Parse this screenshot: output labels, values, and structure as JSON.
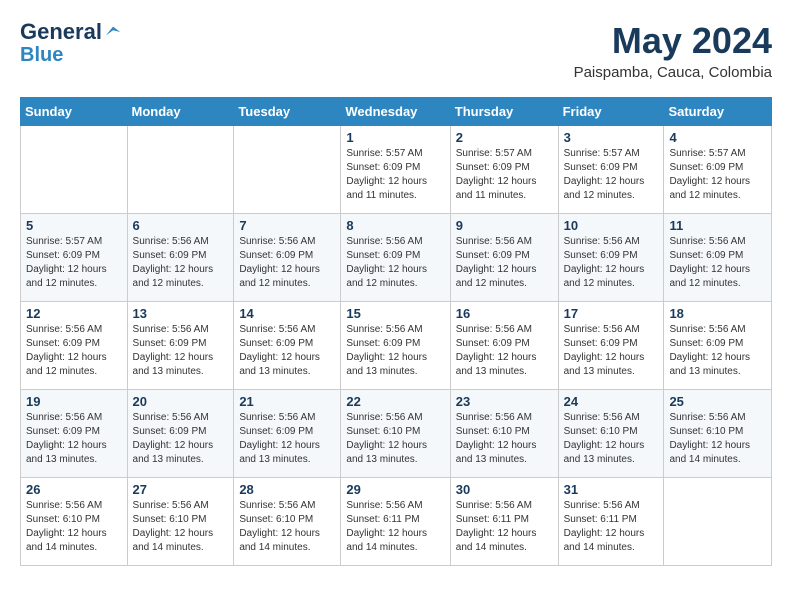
{
  "header": {
    "logo_line1": "General",
    "logo_line2": "Blue",
    "month_title": "May 2024",
    "location": "Paispamba, Cauca, Colombia"
  },
  "weekdays": [
    "Sunday",
    "Monday",
    "Tuesday",
    "Wednesday",
    "Thursday",
    "Friday",
    "Saturday"
  ],
  "weeks": [
    [
      {
        "day": "",
        "info": ""
      },
      {
        "day": "",
        "info": ""
      },
      {
        "day": "",
        "info": ""
      },
      {
        "day": "1",
        "info": "Sunrise: 5:57 AM\nSunset: 6:09 PM\nDaylight: 12 hours\nand 11 minutes."
      },
      {
        "day": "2",
        "info": "Sunrise: 5:57 AM\nSunset: 6:09 PM\nDaylight: 12 hours\nand 11 minutes."
      },
      {
        "day": "3",
        "info": "Sunrise: 5:57 AM\nSunset: 6:09 PM\nDaylight: 12 hours\nand 12 minutes."
      },
      {
        "day": "4",
        "info": "Sunrise: 5:57 AM\nSunset: 6:09 PM\nDaylight: 12 hours\nand 12 minutes."
      }
    ],
    [
      {
        "day": "5",
        "info": "Sunrise: 5:57 AM\nSunset: 6:09 PM\nDaylight: 12 hours\nand 12 minutes."
      },
      {
        "day": "6",
        "info": "Sunrise: 5:56 AM\nSunset: 6:09 PM\nDaylight: 12 hours\nand 12 minutes."
      },
      {
        "day": "7",
        "info": "Sunrise: 5:56 AM\nSunset: 6:09 PM\nDaylight: 12 hours\nand 12 minutes."
      },
      {
        "day": "8",
        "info": "Sunrise: 5:56 AM\nSunset: 6:09 PM\nDaylight: 12 hours\nand 12 minutes."
      },
      {
        "day": "9",
        "info": "Sunrise: 5:56 AM\nSunset: 6:09 PM\nDaylight: 12 hours\nand 12 minutes."
      },
      {
        "day": "10",
        "info": "Sunrise: 5:56 AM\nSunset: 6:09 PM\nDaylight: 12 hours\nand 12 minutes."
      },
      {
        "day": "11",
        "info": "Sunrise: 5:56 AM\nSunset: 6:09 PM\nDaylight: 12 hours\nand 12 minutes."
      }
    ],
    [
      {
        "day": "12",
        "info": "Sunrise: 5:56 AM\nSunset: 6:09 PM\nDaylight: 12 hours\nand 12 minutes."
      },
      {
        "day": "13",
        "info": "Sunrise: 5:56 AM\nSunset: 6:09 PM\nDaylight: 12 hours\nand 13 minutes."
      },
      {
        "day": "14",
        "info": "Sunrise: 5:56 AM\nSunset: 6:09 PM\nDaylight: 12 hours\nand 13 minutes."
      },
      {
        "day": "15",
        "info": "Sunrise: 5:56 AM\nSunset: 6:09 PM\nDaylight: 12 hours\nand 13 minutes."
      },
      {
        "day": "16",
        "info": "Sunrise: 5:56 AM\nSunset: 6:09 PM\nDaylight: 12 hours\nand 13 minutes."
      },
      {
        "day": "17",
        "info": "Sunrise: 5:56 AM\nSunset: 6:09 PM\nDaylight: 12 hours\nand 13 minutes."
      },
      {
        "day": "18",
        "info": "Sunrise: 5:56 AM\nSunset: 6:09 PM\nDaylight: 12 hours\nand 13 minutes."
      }
    ],
    [
      {
        "day": "19",
        "info": "Sunrise: 5:56 AM\nSunset: 6:09 PM\nDaylight: 12 hours\nand 13 minutes."
      },
      {
        "day": "20",
        "info": "Sunrise: 5:56 AM\nSunset: 6:09 PM\nDaylight: 12 hours\nand 13 minutes."
      },
      {
        "day": "21",
        "info": "Sunrise: 5:56 AM\nSunset: 6:09 PM\nDaylight: 12 hours\nand 13 minutes."
      },
      {
        "day": "22",
        "info": "Sunrise: 5:56 AM\nSunset: 6:10 PM\nDaylight: 12 hours\nand 13 minutes."
      },
      {
        "day": "23",
        "info": "Sunrise: 5:56 AM\nSunset: 6:10 PM\nDaylight: 12 hours\nand 13 minutes."
      },
      {
        "day": "24",
        "info": "Sunrise: 5:56 AM\nSunset: 6:10 PM\nDaylight: 12 hours\nand 13 minutes."
      },
      {
        "day": "25",
        "info": "Sunrise: 5:56 AM\nSunset: 6:10 PM\nDaylight: 12 hours\nand 14 minutes."
      }
    ],
    [
      {
        "day": "26",
        "info": "Sunrise: 5:56 AM\nSunset: 6:10 PM\nDaylight: 12 hours\nand 14 minutes."
      },
      {
        "day": "27",
        "info": "Sunrise: 5:56 AM\nSunset: 6:10 PM\nDaylight: 12 hours\nand 14 minutes."
      },
      {
        "day": "28",
        "info": "Sunrise: 5:56 AM\nSunset: 6:10 PM\nDaylight: 12 hours\nand 14 minutes."
      },
      {
        "day": "29",
        "info": "Sunrise: 5:56 AM\nSunset: 6:11 PM\nDaylight: 12 hours\nand 14 minutes."
      },
      {
        "day": "30",
        "info": "Sunrise: 5:56 AM\nSunset: 6:11 PM\nDaylight: 12 hours\nand 14 minutes."
      },
      {
        "day": "31",
        "info": "Sunrise: 5:56 AM\nSunset: 6:11 PM\nDaylight: 12 hours\nand 14 minutes."
      },
      {
        "day": "",
        "info": ""
      }
    ]
  ]
}
